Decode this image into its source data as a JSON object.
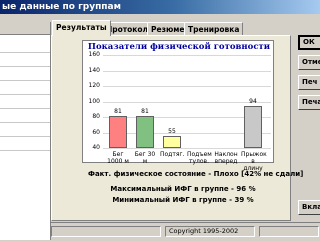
{
  "window": {
    "title": "ые данные по группам"
  },
  "tabs": [
    {
      "label": "Результаты",
      "active": true
    },
    {
      "label": "Протокол",
      "active": false
    },
    {
      "label": "Резюме",
      "active": false
    },
    {
      "label": "Тренировка",
      "active": false
    }
  ],
  "chart_data": {
    "type": "bar",
    "title": "Показатели физической готовности",
    "categories": [
      [
        "Бег",
        "1000 м"
      ],
      [
        "Бег 30",
        "м"
      ],
      [
        "Подтяг."
      ],
      [
        "Подъем",
        "тулов."
      ],
      [
        "Наклон",
        "вперед"
      ],
      [
        "Прыжок",
        "в длину"
      ]
    ],
    "values": [
      81,
      81,
      55,
      null,
      null,
      94
    ],
    "value_labels": [
      "81",
      "81",
      "55",
      "",
      "",
      "94"
    ],
    "colors": [
      "#ff8080",
      "#80c080",
      "#ffffa0",
      "",
      "",
      "#c8c8c8"
    ],
    "yticks": [
      "160",
      "140",
      "120",
      "100",
      "80",
      "60",
      "40"
    ],
    "ylim": [
      40,
      160
    ],
    "grid": true
  },
  "summary": {
    "state": "Факт. физическое состояние - Плохо [42% не сдали]",
    "max": "Максимальный ИФГ в группе - 96 %",
    "min": "Минимальный ИФГ в группе - 39 %"
  },
  "buttons": [
    "ОК",
    "Отме",
    "Печ",
    "Печа"
  ],
  "bottom_right": "Вкла",
  "status": {
    "copyright": "Copyright 1995-2002"
  }
}
